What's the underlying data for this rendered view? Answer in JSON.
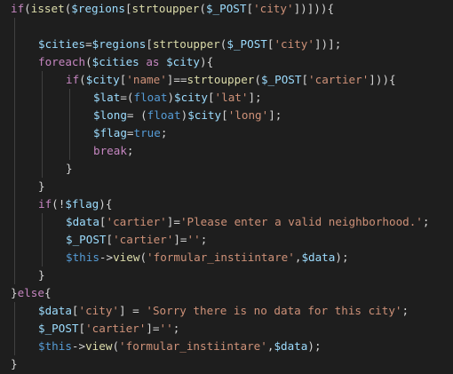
{
  "theme": {
    "background": "#1e1e1e",
    "text": "#d4d4d4",
    "keyword": "#c586c0",
    "variable": "#9cdcfe",
    "function": "#dcdcaa",
    "string": "#ce9178",
    "type": "#569cd6",
    "punctuation": "#d4d4d4"
  },
  "code": {
    "lines": [
      {
        "indent": 0,
        "tokens": [
          {
            "t": "if",
            "c": "keyword"
          },
          {
            "t": "(",
            "c": "punctuation"
          },
          {
            "t": "isset",
            "c": "function"
          },
          {
            "t": "(",
            "c": "punctuation"
          },
          {
            "t": "$regions",
            "c": "variable"
          },
          {
            "t": "[",
            "c": "punctuation"
          },
          {
            "t": "strtoupper",
            "c": "function"
          },
          {
            "t": "(",
            "c": "punctuation"
          },
          {
            "t": "$_POST",
            "c": "variable"
          },
          {
            "t": "[",
            "c": "punctuation"
          },
          {
            "t": "'city'",
            "c": "string"
          },
          {
            "t": "])])){",
            "c": "punctuation"
          }
        ]
      },
      {
        "indent": 0,
        "tokens": []
      },
      {
        "indent": 1,
        "tokens": [
          {
            "t": "$cities",
            "c": "variable"
          },
          {
            "t": "=",
            "c": "punctuation"
          },
          {
            "t": "$regions",
            "c": "variable"
          },
          {
            "t": "[",
            "c": "punctuation"
          },
          {
            "t": "strtoupper",
            "c": "function"
          },
          {
            "t": "(",
            "c": "punctuation"
          },
          {
            "t": "$_POST",
            "c": "variable"
          },
          {
            "t": "[",
            "c": "punctuation"
          },
          {
            "t": "'city'",
            "c": "string"
          },
          {
            "t": "])];",
            "c": "punctuation"
          }
        ]
      },
      {
        "indent": 1,
        "tokens": [
          {
            "t": "foreach",
            "c": "keyword"
          },
          {
            "t": "(",
            "c": "punctuation"
          },
          {
            "t": "$cities",
            "c": "variable"
          },
          {
            "t": " as ",
            "c": "keyword"
          },
          {
            "t": "$city",
            "c": "variable"
          },
          {
            "t": "){",
            "c": "punctuation"
          }
        ]
      },
      {
        "indent": 2,
        "tokens": [
          {
            "t": "if",
            "c": "keyword"
          },
          {
            "t": "(",
            "c": "punctuation"
          },
          {
            "t": "$city",
            "c": "variable"
          },
          {
            "t": "[",
            "c": "punctuation"
          },
          {
            "t": "'name'",
            "c": "string"
          },
          {
            "t": "]==",
            "c": "punctuation"
          },
          {
            "t": "strtoupper",
            "c": "function"
          },
          {
            "t": "(",
            "c": "punctuation"
          },
          {
            "t": "$_POST",
            "c": "variable"
          },
          {
            "t": "[",
            "c": "punctuation"
          },
          {
            "t": "'cartier'",
            "c": "string"
          },
          {
            "t": "])){",
            "c": "punctuation"
          }
        ]
      },
      {
        "indent": 3,
        "tokens": [
          {
            "t": "$lat",
            "c": "variable"
          },
          {
            "t": "=(",
            "c": "punctuation"
          },
          {
            "t": "float",
            "c": "type"
          },
          {
            "t": ")",
            "c": "punctuation"
          },
          {
            "t": "$city",
            "c": "variable"
          },
          {
            "t": "[",
            "c": "punctuation"
          },
          {
            "t": "'lat'",
            "c": "string"
          },
          {
            "t": "];",
            "c": "punctuation"
          }
        ]
      },
      {
        "indent": 3,
        "tokens": [
          {
            "t": "$long",
            "c": "variable"
          },
          {
            "t": "= (",
            "c": "punctuation"
          },
          {
            "t": "float",
            "c": "type"
          },
          {
            "t": ")",
            "c": "punctuation"
          },
          {
            "t": "$city",
            "c": "variable"
          },
          {
            "t": "[",
            "c": "punctuation"
          },
          {
            "t": "'long'",
            "c": "string"
          },
          {
            "t": "];",
            "c": "punctuation"
          }
        ]
      },
      {
        "indent": 3,
        "tokens": [
          {
            "t": "$flag",
            "c": "variable"
          },
          {
            "t": "=",
            "c": "punctuation"
          },
          {
            "t": "true",
            "c": "type"
          },
          {
            "t": ";",
            "c": "punctuation"
          }
        ]
      },
      {
        "indent": 3,
        "tokens": [
          {
            "t": "break",
            "c": "keyword"
          },
          {
            "t": ";",
            "c": "punctuation"
          }
        ]
      },
      {
        "indent": 2,
        "tokens": [
          {
            "t": "}",
            "c": "punctuation"
          }
        ]
      },
      {
        "indent": 1,
        "tokens": [
          {
            "t": "}",
            "c": "punctuation"
          }
        ]
      },
      {
        "indent": 1,
        "tokens": [
          {
            "t": "if",
            "c": "keyword"
          },
          {
            "t": "(!",
            "c": "punctuation"
          },
          {
            "t": "$flag",
            "c": "variable"
          },
          {
            "t": "){",
            "c": "punctuation"
          }
        ]
      },
      {
        "indent": 2,
        "tokens": [
          {
            "t": "$data",
            "c": "variable"
          },
          {
            "t": "[",
            "c": "punctuation"
          },
          {
            "t": "'cartier'",
            "c": "string"
          },
          {
            "t": "]=",
            "c": "punctuation"
          },
          {
            "t": "'Please enter a valid neighborhood.'",
            "c": "string"
          },
          {
            "t": ";",
            "c": "punctuation"
          }
        ]
      },
      {
        "indent": 2,
        "tokens": [
          {
            "t": "$_POST",
            "c": "variable"
          },
          {
            "t": "[",
            "c": "punctuation"
          },
          {
            "t": "'cartier'",
            "c": "string"
          },
          {
            "t": "]=",
            "c": "punctuation"
          },
          {
            "t": "''",
            "c": "string"
          },
          {
            "t": ";",
            "c": "punctuation"
          }
        ]
      },
      {
        "indent": 2,
        "tokens": [
          {
            "t": "$this",
            "c": "type"
          },
          {
            "t": "->",
            "c": "punctuation"
          },
          {
            "t": "view",
            "c": "function"
          },
          {
            "t": "(",
            "c": "punctuation"
          },
          {
            "t": "'formular_instiintare'",
            "c": "string"
          },
          {
            "t": ",",
            "c": "punctuation"
          },
          {
            "t": "$data",
            "c": "variable"
          },
          {
            "t": ");",
            "c": "punctuation"
          }
        ]
      },
      {
        "indent": 1,
        "tokens": [
          {
            "t": "}",
            "c": "punctuation"
          }
        ]
      },
      {
        "indent": 0,
        "tokens": [
          {
            "t": "}",
            "c": "punctuation"
          },
          {
            "t": "else",
            "c": "keyword"
          },
          {
            "t": "{",
            "c": "punctuation"
          }
        ]
      },
      {
        "indent": 1,
        "tokens": [
          {
            "t": "$data",
            "c": "variable"
          },
          {
            "t": "[",
            "c": "punctuation"
          },
          {
            "t": "'city'",
            "c": "string"
          },
          {
            "t": "] = ",
            "c": "punctuation"
          },
          {
            "t": "'Sorry there is no data for this city'",
            "c": "string"
          },
          {
            "t": ";",
            "c": "punctuation"
          }
        ]
      },
      {
        "indent": 1,
        "tokens": [
          {
            "t": "$_POST",
            "c": "variable"
          },
          {
            "t": "[",
            "c": "punctuation"
          },
          {
            "t": "'cartier'",
            "c": "string"
          },
          {
            "t": "]=",
            "c": "punctuation"
          },
          {
            "t": "''",
            "c": "string"
          },
          {
            "t": ";",
            "c": "punctuation"
          }
        ]
      },
      {
        "indent": 1,
        "tokens": [
          {
            "t": "$this",
            "c": "type"
          },
          {
            "t": "->",
            "c": "punctuation"
          },
          {
            "t": "view",
            "c": "function"
          },
          {
            "t": "(",
            "c": "punctuation"
          },
          {
            "t": "'formular_instiintare'",
            "c": "string"
          },
          {
            "t": ",",
            "c": "punctuation"
          },
          {
            "t": "$data",
            "c": "variable"
          },
          {
            "t": ");",
            "c": "punctuation"
          }
        ]
      },
      {
        "indent": 0,
        "tokens": [
          {
            "t": "}",
            "c": "punctuation"
          }
        ]
      }
    ],
    "guides": [
      {
        "level": 1,
        "from": 1,
        "to": 16
      },
      {
        "level": 2,
        "from": 4,
        "to": 10
      },
      {
        "level": 3,
        "from": 5,
        "to": 9
      },
      {
        "level": 2,
        "from": 12,
        "to": 15
      },
      {
        "level": 1,
        "from": 17,
        "to": 20
      }
    ]
  }
}
